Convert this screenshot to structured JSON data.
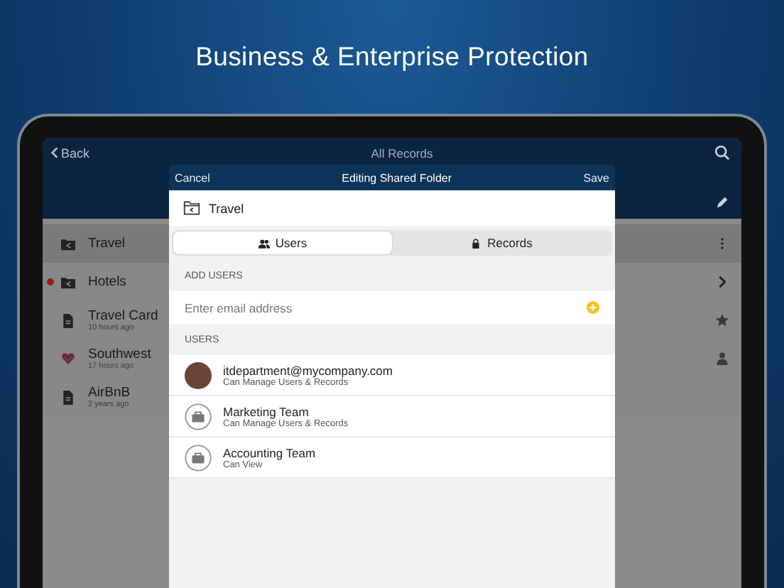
{
  "headline": "Business & Enterprise Protection",
  "nav": {
    "back": "Back",
    "title": "All Records"
  },
  "records": [
    {
      "kind": "shared-folder",
      "name": "Travel",
      "selected": true,
      "flagged": false
    },
    {
      "kind": "shared-folder",
      "name": "Hotels",
      "selected": false,
      "flagged": true
    },
    {
      "kind": "record",
      "name": "Travel Card",
      "subtitle": "10 hours ago",
      "selected": false,
      "flagged": false
    },
    {
      "kind": "logo",
      "name": "Southwest",
      "subtitle": "17 hours ago",
      "selected": false,
      "flagged": false
    },
    {
      "kind": "record",
      "name": "AirBnB",
      "subtitle": "2 years ago",
      "selected": false,
      "flagged": false
    }
  ],
  "dialog": {
    "cancel": "Cancel",
    "title": "Editing Shared Folder",
    "save": "Save",
    "folder": "Travel",
    "tabs": [
      {
        "label": "Users",
        "selected": true
      },
      {
        "label": "Records",
        "selected": false
      }
    ],
    "add_users": {
      "heading": "ADD USERS",
      "placeholder": "Enter email address"
    },
    "users_heading": "USERS",
    "users": [
      {
        "kind": "person",
        "name": "itdepartment@mycompany.com",
        "role": "Can Manage Users & Records"
      },
      {
        "kind": "team",
        "name": "Marketing Team",
        "role": "Can Manage Users & Records"
      },
      {
        "kind": "team",
        "name": "Accounting Team",
        "role": "Can View"
      }
    ]
  }
}
